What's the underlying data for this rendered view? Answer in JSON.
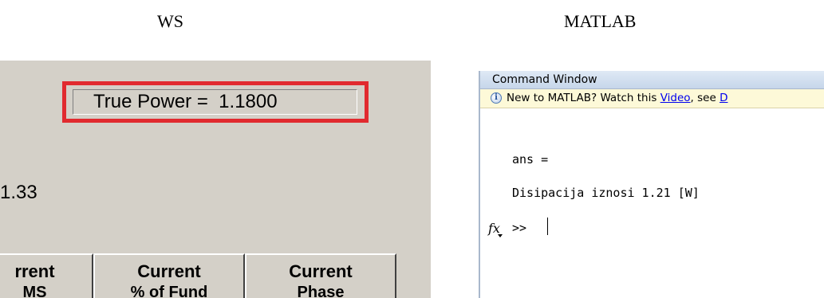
{
  "captions": {
    "left": "WS",
    "right": "MATLAB"
  },
  "ws": {
    "true_power_label": "True Power =  1.1800",
    "value_text": "1.33",
    "columns": [
      {
        "line1": "rrent",
        "line2": "MS"
      },
      {
        "line1": "Current",
        "line2": "% of Fund"
      },
      {
        "line1": "Current",
        "line2": "Phase"
      }
    ],
    "highlight_color": "#e12a2f"
  },
  "matlab": {
    "window_title": "Command Window",
    "info_icon": "info-icon",
    "info_prefix": "New to MATLAB? Watch this ",
    "info_link_video": "Video",
    "info_mid": ", see ",
    "info_link_demos": "D",
    "ans_line": "ans =",
    "result_line": "Disipacija iznosi 1.21 [W]",
    "fx_label": "fx",
    "prompt": ">>"
  }
}
